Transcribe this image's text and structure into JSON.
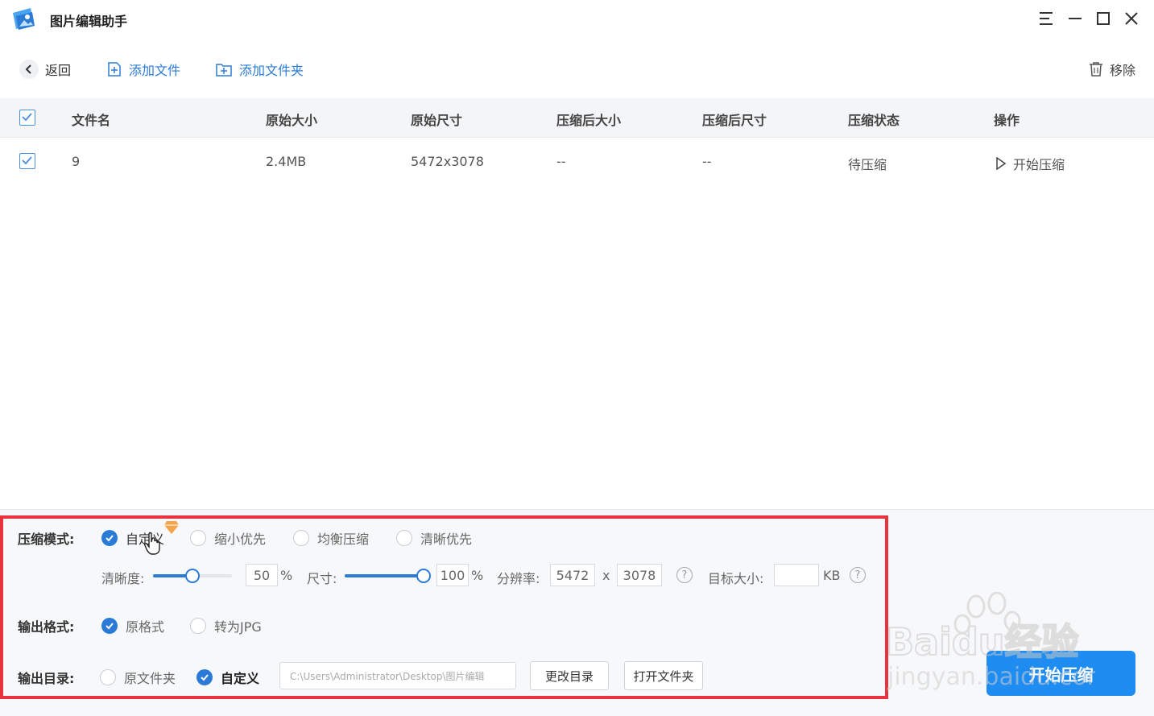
{
  "app": {
    "title": "图片编辑助手"
  },
  "toolbar": {
    "back": "返回",
    "add_file": "添加文件",
    "add_folder": "添加文件夹",
    "remove": "移除"
  },
  "table": {
    "headers": [
      "文件名",
      "原始大小",
      "原始尺寸",
      "压缩后大小",
      "压缩后尺寸",
      "压缩状态",
      "操作"
    ],
    "rows": [
      {
        "name": "9",
        "orig_size": "2.4MB",
        "orig_dim": "5472x3078",
        "comp_size": "--",
        "comp_dim": "--",
        "status": "待压缩",
        "action": "开始压缩"
      }
    ]
  },
  "settings": {
    "mode_label": "压缩模式:",
    "modes": [
      "自定义",
      "缩小优先",
      "均衡压缩",
      "清晰优先"
    ],
    "selected_mode": "自定义",
    "clarity_label": "清晰度:",
    "clarity_value": "50",
    "clarity_level": 0.5,
    "percent": "%",
    "size_label": "尺寸:",
    "size_value": "100",
    "size_level": 1.0,
    "resolution_label": "分辨率:",
    "res_w": "5472",
    "res_x": "x",
    "res_h": "3078",
    "help": "?",
    "target_label": "目标大小:",
    "target_value": "",
    "target_unit": "KB",
    "format_label": "输出格式:",
    "formats": [
      "原格式",
      "转为JPG"
    ],
    "selected_format": "原格式",
    "dir_label": "输出目录:",
    "dirs": [
      "原文件夹",
      "自定义"
    ],
    "selected_dir": "自定义",
    "dir_path": "C:\\Users\\Administrator\\Desktop\\图片编辑",
    "change_dir": "更改目录",
    "open_folder": "打开文件夹"
  },
  "start_button": "开始压缩",
  "watermark": {
    "line1": "Baidu经验",
    "line2": "jingyan.baidu.com"
  },
  "colors": {
    "accent": "#2b7bd6",
    "highlight_frame": "#e8323c",
    "start_button": "#1e8cf0"
  }
}
